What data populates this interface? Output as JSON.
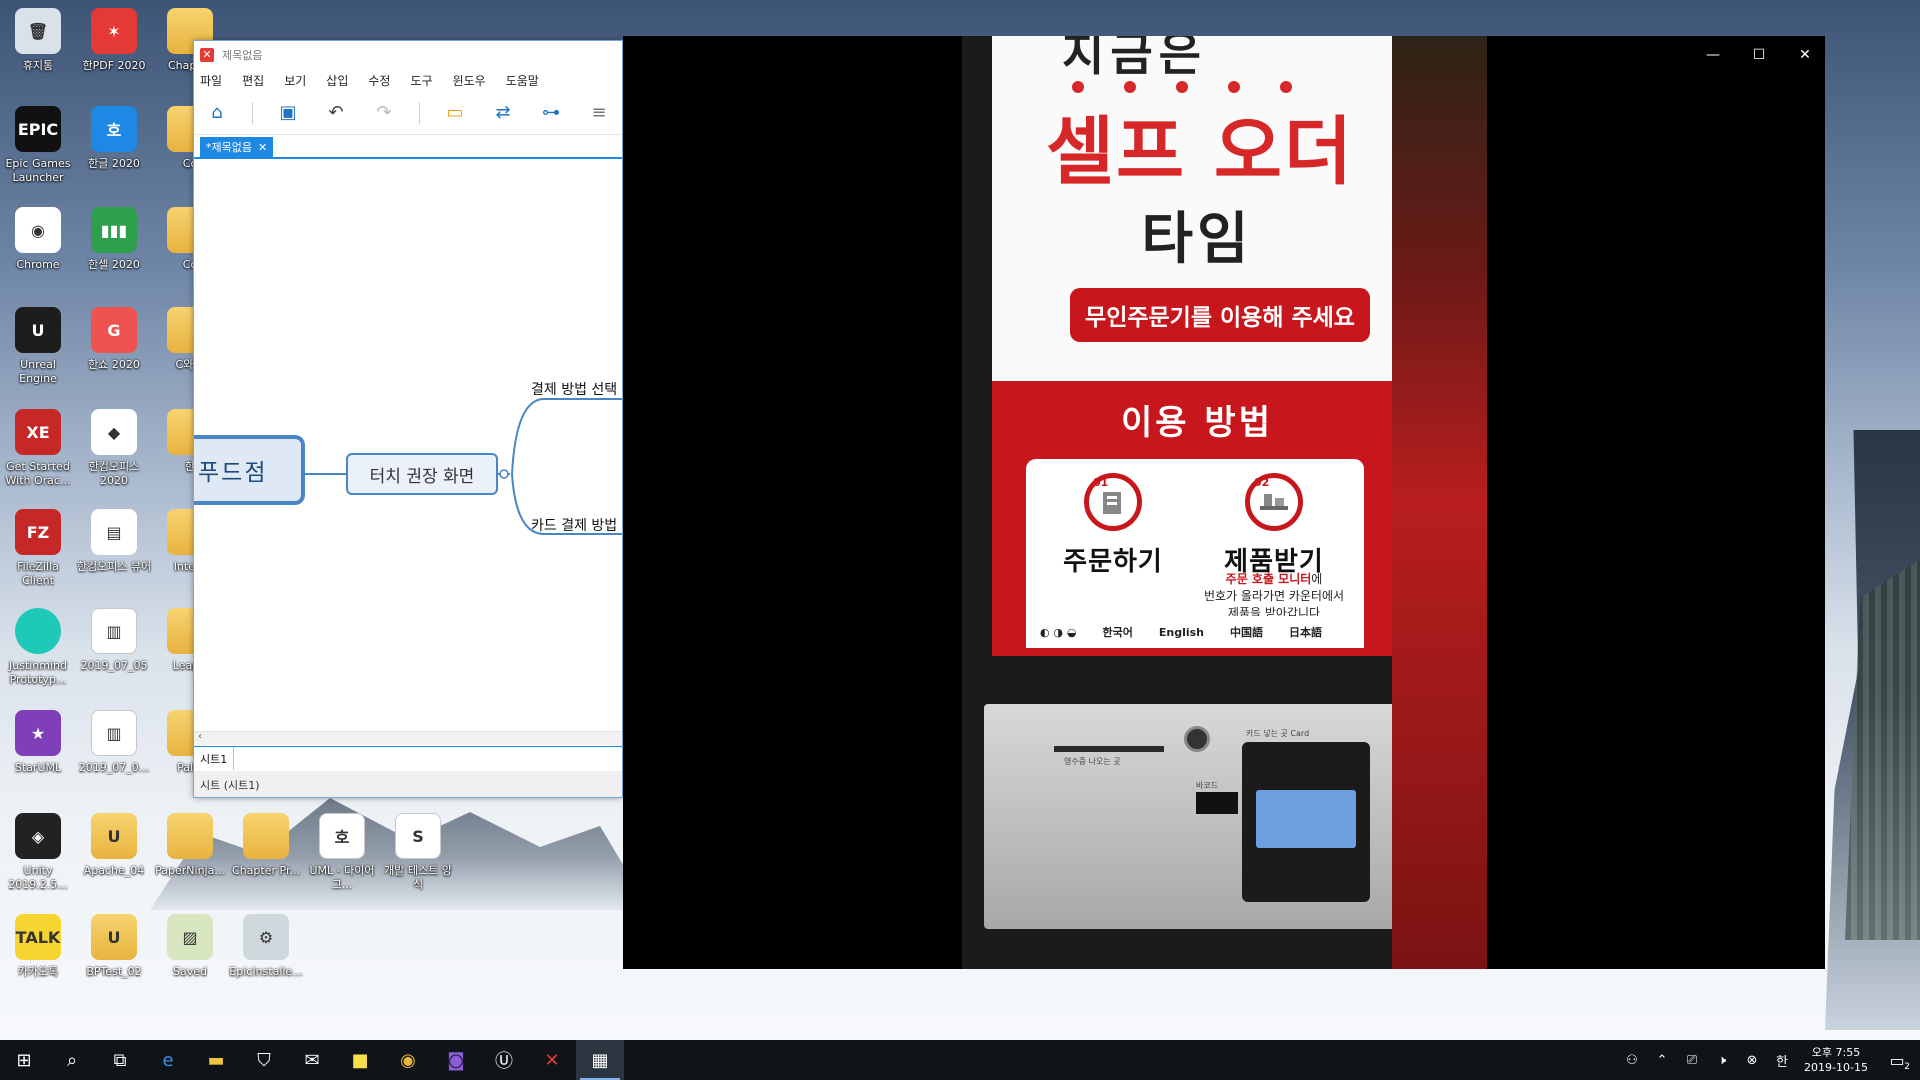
{
  "desktop": {
    "icons": [
      {
        "label": "휴지통",
        "glyph": "🗑",
        "color": "#d9e2ea",
        "kind": "app"
      },
      {
        "label": "한PDF 2020",
        "glyph": "✶",
        "color": "#e53935",
        "kind": "app"
      },
      {
        "label": "Chapter",
        "glyph": "",
        "color": "#e8b33f",
        "kind": "folder"
      },
      {
        "label": "Epic Games Launcher",
        "glyph": "EPIC",
        "color": "#111111",
        "kind": "app"
      },
      {
        "label": "한글 2020",
        "glyph": "호",
        "color": "#1e88e5",
        "kind": "app"
      },
      {
        "label": "Co",
        "glyph": "",
        "color": "#e8b33f",
        "kind": "folder"
      },
      {
        "label": "Chrome",
        "glyph": "◉",
        "color": "#ffffff",
        "kind": "app"
      },
      {
        "label": "한셀 2020",
        "glyph": "▮▮▮",
        "color": "#2e9f4d",
        "kind": "app"
      },
      {
        "label": "Co",
        "glyph": "",
        "color": "#e8b33f",
        "kind": "folder"
      },
      {
        "label": "Unreal Engine",
        "glyph": "U",
        "color": "#1d1d1d",
        "kind": "app"
      },
      {
        "label": "한쇼 2020",
        "glyph": "G",
        "color": "#ef5350",
        "kind": "app"
      },
      {
        "label": "C와 C",
        "glyph": "",
        "color": "#e8b33f",
        "kind": "folder"
      },
      {
        "label": "Get Started With Orac...",
        "glyph": "XE",
        "color": "#c62828",
        "kind": "app"
      },
      {
        "label": "한컴오피스 2020",
        "glyph": "◆",
        "color": "#ffffff",
        "kind": "app"
      },
      {
        "label": "한",
        "glyph": "",
        "color": "#e8b33f",
        "kind": "folder"
      },
      {
        "label": "FileZilla Client",
        "glyph": "FZ",
        "color": "#c62828",
        "kind": "app"
      },
      {
        "label": "한컴오피스 뷰어",
        "glyph": "▤",
        "color": "#ffffff",
        "kind": "app"
      },
      {
        "label": "Intern",
        "glyph": "",
        "color": "#e8b33f",
        "kind": "folder"
      },
      {
        "label": "Justinmind Prototyp...",
        "glyph": "",
        "color": "#1ec9b7",
        "kind": "circle"
      },
      {
        "label": "2019_07_05",
        "glyph": "▥",
        "color": "#ffffff",
        "kind": "doc"
      },
      {
        "label": "LeapU",
        "glyph": "",
        "color": "#e8b33f",
        "kind": "folder"
      },
      {
        "label": "StarUML",
        "glyph": "★",
        "color": "#7e3fb8",
        "kind": "app"
      },
      {
        "label": "2019_07_0...",
        "glyph": "▥",
        "color": "#ffffff",
        "kind": "doc"
      },
      {
        "label": "Pallo",
        "glyph": "",
        "color": "#e8b33f",
        "kind": "folder"
      }
    ],
    "bottom_icons": [
      {
        "label": "Unity 2019.2.5...",
        "glyph": "◈",
        "color": "#222222",
        "kind": "app"
      },
      {
        "label": "Apache_04",
        "glyph": "U",
        "color": "#f3d27a",
        "kind": "folder"
      },
      {
        "label": "PaperNinja...",
        "glyph": "",
        "color": "#e8b33f",
        "kind": "folder"
      },
      {
        "label": "Chapter Pr...",
        "glyph": "",
        "color": "#e8b33f",
        "kind": "folder"
      },
      {
        "label": "UML - 다이어그...",
        "glyph": "호",
        "color": "#ffffff",
        "kind": "doc"
      },
      {
        "label": "개발 테스트 양식",
        "glyph": "S",
        "color": "#ffffff",
        "kind": "doc"
      },
      {
        "label": "카카오톡",
        "glyph": "TALK",
        "color": "#f7d531",
        "kind": "app"
      },
      {
        "label": "BPTest_02",
        "glyph": "U",
        "color": "#f3d27a",
        "kind": "folder"
      },
      {
        "label": "Saved",
        "glyph": "▨",
        "color": "#d8e6c0",
        "kind": "app"
      },
      {
        "label": "EpicInstalle...",
        "glyph": "⚙",
        "color": "#cfd8dc",
        "kind": "app"
      }
    ]
  },
  "xmind": {
    "title": "제목없음",
    "menu": [
      "파일",
      "편집",
      "보기",
      "삽입",
      "수정",
      "도구",
      "윈도우",
      "도움말"
    ],
    "tab_label": "*제목없음",
    "central_topic": "푸드점",
    "main_topic": "터치 권장 화면",
    "subtopics": [
      "결제 방법 선택",
      "카드 결제 방법"
    ],
    "sheet_tab": "시트1",
    "status": "시트 (시트1)"
  },
  "player": {
    "video": {
      "cut_title": "지금은",
      "main_title": "셀프 오더",
      "sub_title": "타임",
      "pill_text": "무인주문기를 이용해 주세요",
      "usage_title": "이용 방법",
      "step1_num": "01",
      "step1_label": "주문하기",
      "step2_num": "02",
      "step2_label": "제품받기",
      "note_red": "주문 호출 모니터",
      "note_red_suffix": "에",
      "note_line2": "번호가 올라가면 카운터에서",
      "note_line3": "제품을 받아갑니다",
      "languages": [
        "한국어",
        "English",
        "中国語",
        "日本語"
      ],
      "receipt_label": "영수증 나오는 곳",
      "card_label": "카드 넣는 곳 Card",
      "barcode_label": "바코드"
    }
  },
  "taskbar": {
    "clock_time": "오후 7:55",
    "clock_date": "2019-10-15",
    "notification_count": "2",
    "accent_color": "#7fb2e6"
  }
}
